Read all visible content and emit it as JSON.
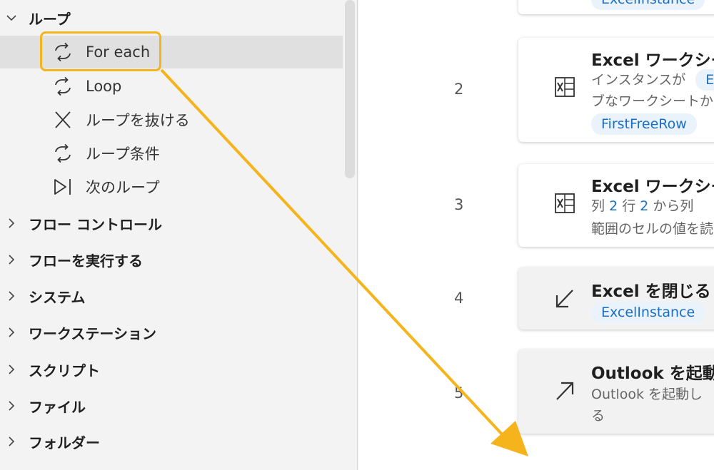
{
  "left_panel": {
    "groups": [
      {
        "label": "ループ",
        "expanded": true,
        "items": [
          "For each",
          "Loop",
          "ループを抜ける",
          "ループ条件",
          "次のループ"
        ]
      },
      {
        "label": "フロー コントロール",
        "expanded": false
      },
      {
        "label": "フローを実行する",
        "expanded": false
      },
      {
        "label": "システム",
        "expanded": false
      },
      {
        "label": "ワークステーション",
        "expanded": false
      },
      {
        "label": "スクリプト",
        "expanded": false
      },
      {
        "label": "ファイル",
        "expanded": false
      },
      {
        "label": "フォルダー",
        "expanded": false
      }
    ],
    "selected_item": "For each"
  },
  "flow_steps": {
    "partial_top": {
      "chip": "ExcelInstance"
    },
    "steps": [
      {
        "number": "2",
        "title": "Excel ワークシー",
        "line1_prefix": "インスタンスが",
        "line1_chip": "Ex",
        "line2": "ブなワークシートから",
        "chip": "FirstFreeRow"
      },
      {
        "number": "3",
        "title": "Excel ワークシー",
        "l1_a": "列",
        "l1_b": "2",
        "l1_c": "行",
        "l1_d": "2",
        "l1_e": "から列",
        "line2": "範囲のセルの値を読"
      },
      {
        "number": "4",
        "title": "Excel を閉じる",
        "chip": "ExcelInstance"
      },
      {
        "number": "5",
        "title": "Outlook を起動",
        "line1": "Outlook を起動し",
        "line2": "る"
      }
    ]
  },
  "colors": {
    "highlight": "#f5b41c",
    "chip_text": "#1a6fc4",
    "chip_bg": "#eaf2fb"
  }
}
